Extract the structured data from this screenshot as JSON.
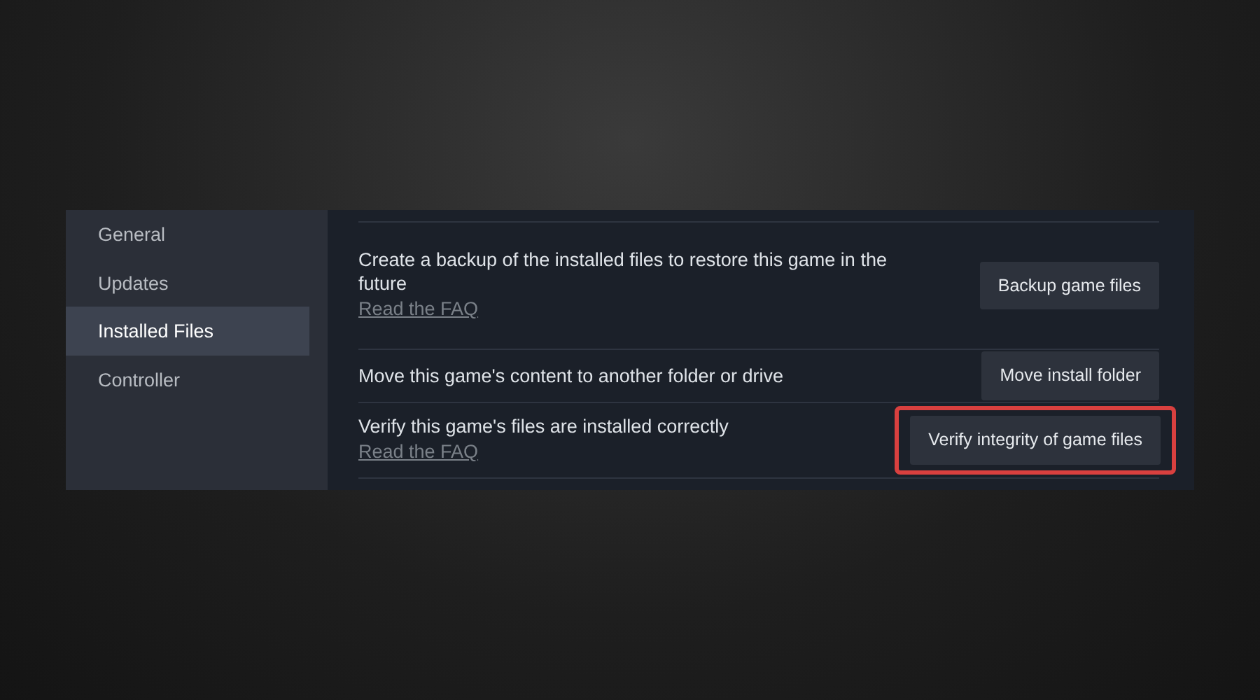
{
  "sidebar": {
    "items": [
      {
        "label": "General",
        "selected": false
      },
      {
        "label": "Updates",
        "selected": false
      },
      {
        "label": "Installed Files",
        "selected": true
      },
      {
        "label": "Controller",
        "selected": false
      }
    ]
  },
  "rows": [
    {
      "description": "Create a backup of the installed files to restore this game in the future",
      "link": "Read the FAQ",
      "button": "Backup game files",
      "highlighted": false
    },
    {
      "description": "Move this game's content to another folder or drive",
      "button": "Move install folder",
      "highlighted": false
    },
    {
      "description": "Verify this game's files are installed correctly",
      "link": "Read the FAQ",
      "button": "Verify integrity of game files",
      "highlighted": true
    }
  ]
}
